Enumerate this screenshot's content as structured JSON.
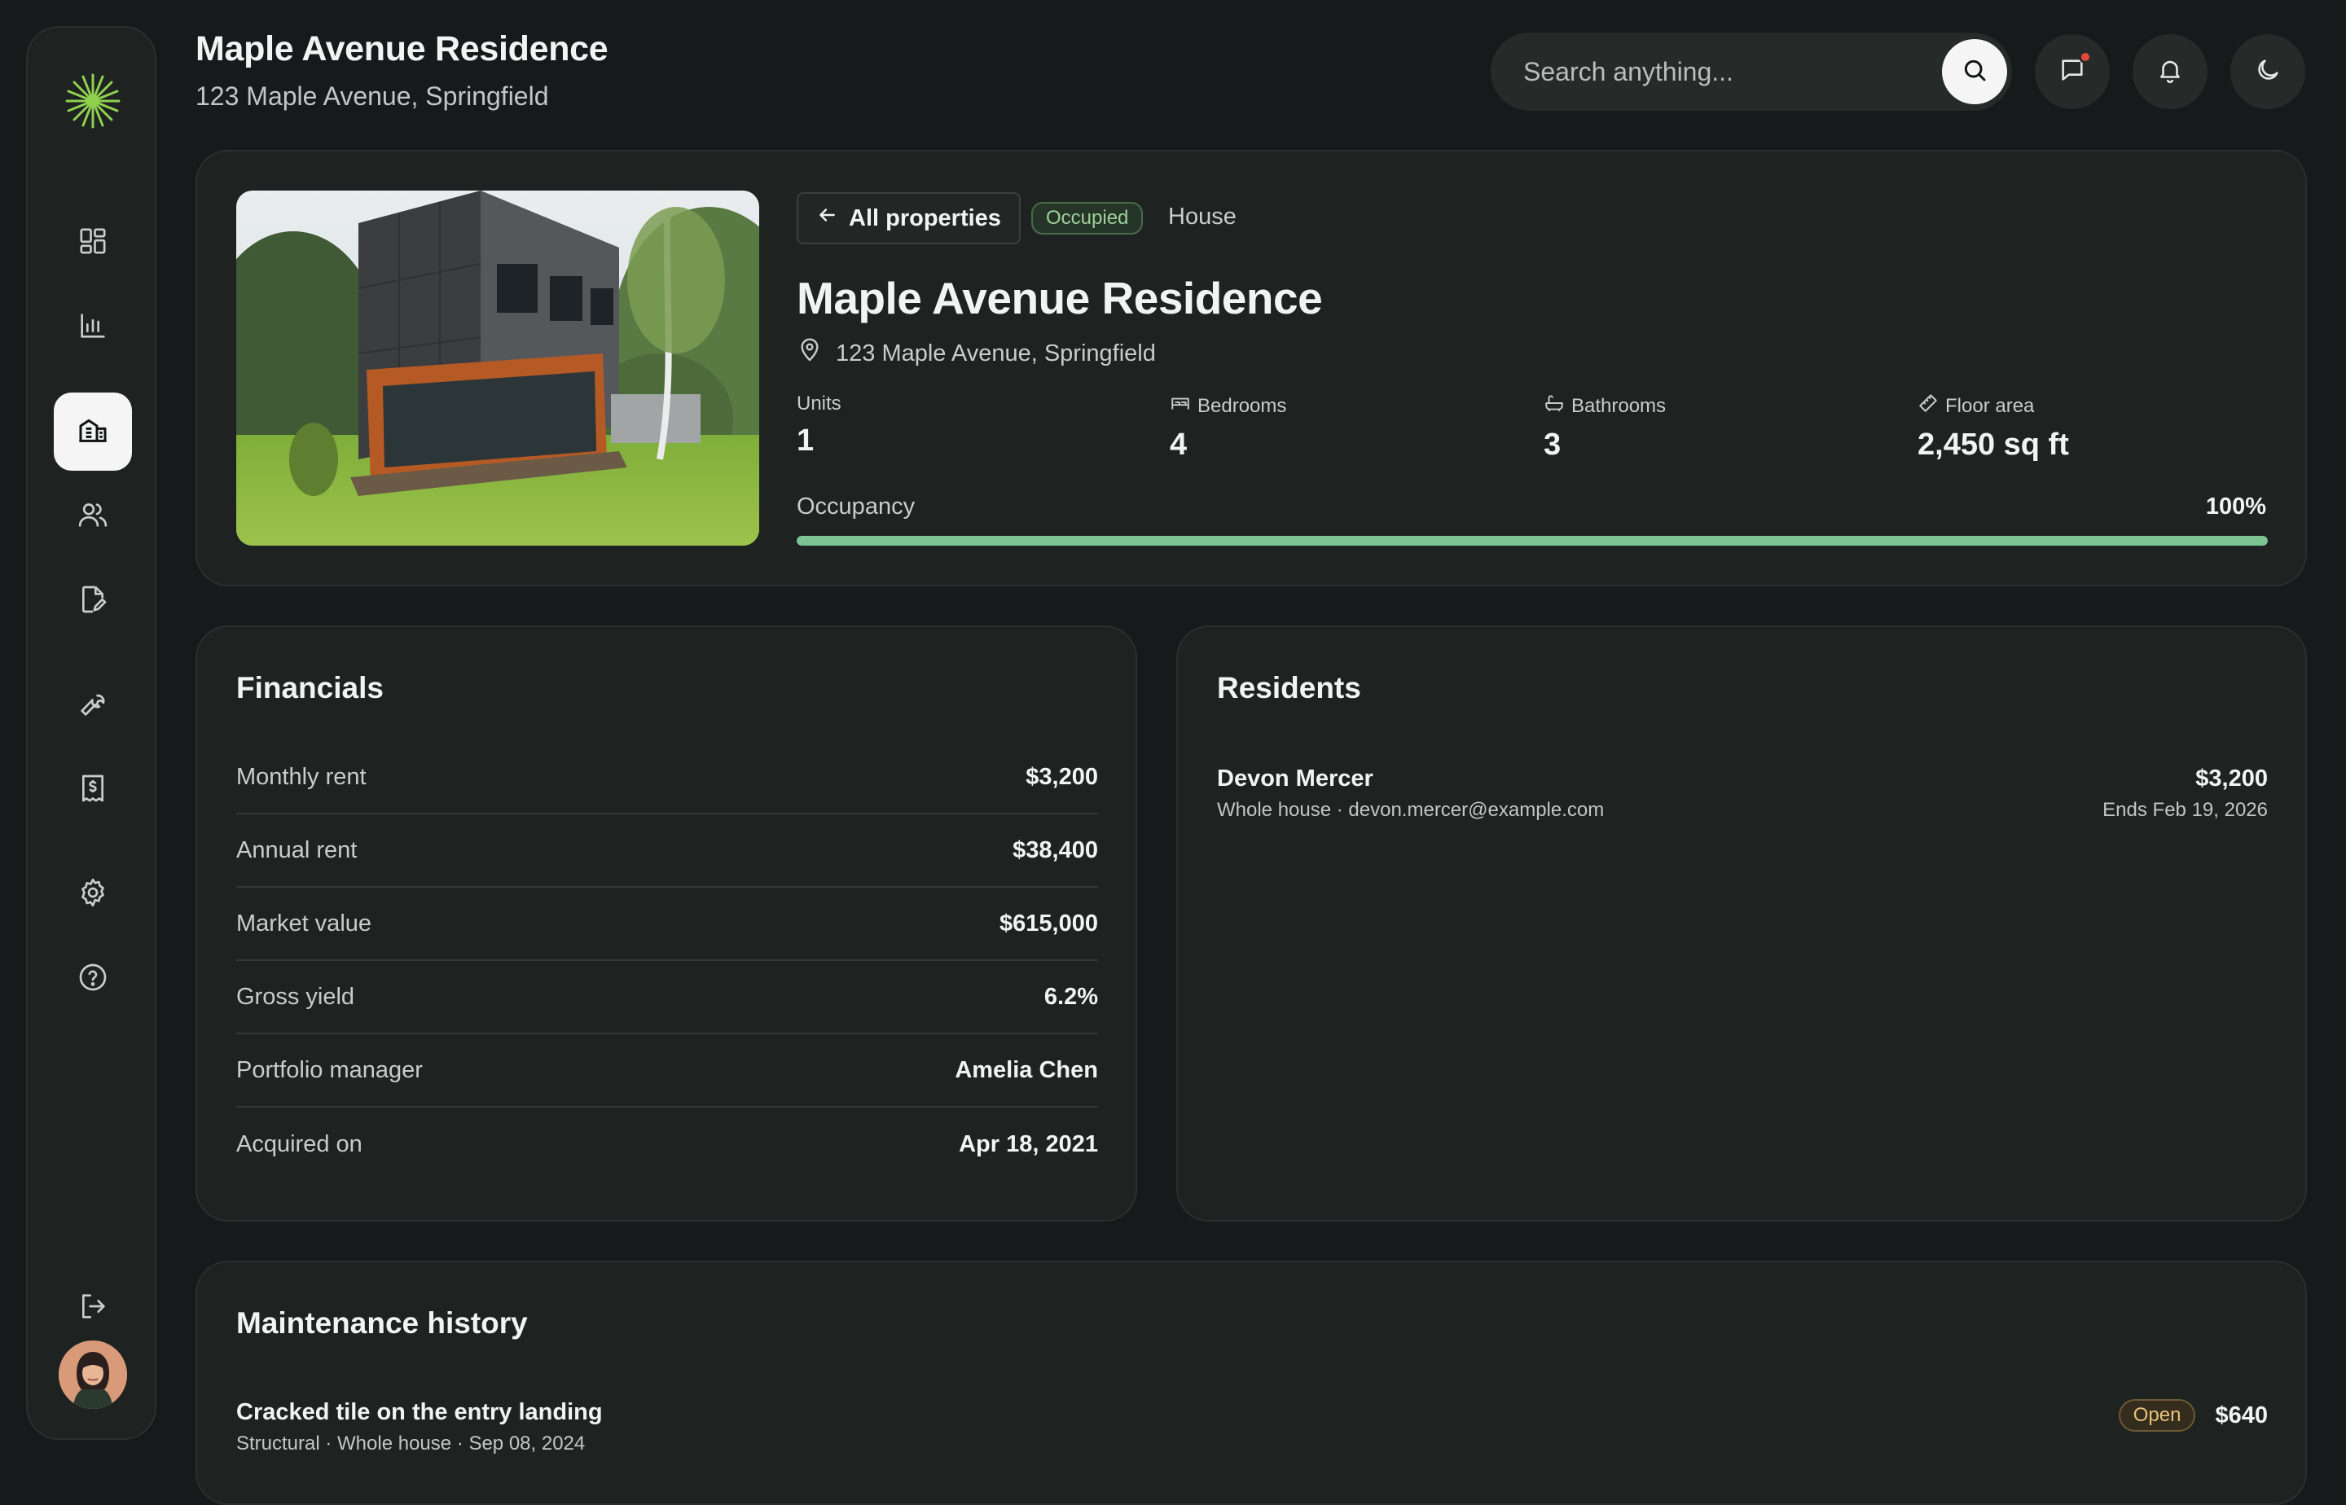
{
  "header": {
    "title": "Maple Avenue Residence",
    "subtitle": "123 Maple Avenue, Springfield",
    "search_placeholder": "Search anything..."
  },
  "sidebar": {
    "items": [
      {
        "icon": "dashboard-icon"
      },
      {
        "icon": "analytics-icon"
      },
      {
        "icon": "building-icon",
        "active": true
      },
      {
        "icon": "users-icon"
      },
      {
        "icon": "document-edit-icon"
      },
      {
        "icon": "wrench-icon"
      },
      {
        "icon": "invoice-icon"
      },
      {
        "icon": "settings-icon"
      },
      {
        "icon": "help-icon"
      },
      {
        "icon": "logout-icon"
      }
    ]
  },
  "property": {
    "back_label": "All properties",
    "status": "Occupied",
    "type": "House",
    "name": "Maple Avenue Residence",
    "address": "123 Maple Avenue, Springfield",
    "stats": {
      "units_label": "Units",
      "units": "1",
      "bedrooms_label": "Bedrooms",
      "bedrooms": "4",
      "bathrooms_label": "Bathrooms",
      "bathrooms": "3",
      "floor_area_label": "Floor area",
      "floor_area": "2,450 sq ft"
    },
    "occupancy_label": "Occupancy",
    "occupancy_pct": "100%",
    "occupancy_fraction": 1.0
  },
  "financials": {
    "title": "Financials",
    "rows": [
      {
        "label": "Monthly rent",
        "value": "$3,200"
      },
      {
        "label": "Annual rent",
        "value": "$38,400"
      },
      {
        "label": "Market value",
        "value": "$615,000"
      },
      {
        "label": "Gross yield",
        "value": "6.2%"
      },
      {
        "label": "Portfolio manager",
        "value": "Amelia Chen"
      },
      {
        "label": "Acquired on",
        "value": "Apr 18, 2021"
      }
    ]
  },
  "residents": {
    "title": "Residents",
    "items": [
      {
        "name": "Devon Mercer",
        "meta": "Whole house · devon.mercer@example.com",
        "amount": "$3,200",
        "ends": "Ends Feb 19, 2026"
      }
    ]
  },
  "maintenance": {
    "title": "Maintenance history",
    "items": [
      {
        "title": "Cracked tile on the entry landing",
        "meta": "Structural · Whole house · Sep 08, 2024",
        "status": "Open",
        "amount": "$640"
      }
    ]
  },
  "colors": {
    "accent_green": "#7cc494",
    "status_occupied": "#9ed09c",
    "status_open": "#e8c27a",
    "notification": "#e5483e"
  }
}
